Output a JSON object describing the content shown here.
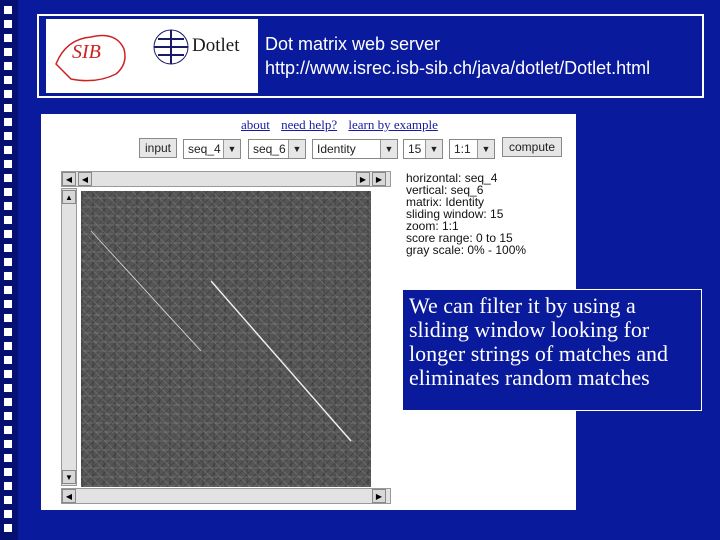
{
  "banner": {
    "title": "Dot matrix web server",
    "url": "http://www.isrec.isb-sib.ch/java/dotlet/Dotlet.html",
    "logo_left_text": "SIB",
    "logo_right_text": "Dotlet"
  },
  "links": [
    "about",
    "need help?",
    "learn by example"
  ],
  "toolbar": {
    "input_label": "input",
    "seq_h": "seq_4",
    "seq_v": "seq_6",
    "matrix": "Identity",
    "window": "15",
    "zoom": "1:1",
    "compute_label": "compute"
  },
  "info": {
    "horizontal": "horizontal: seq_4",
    "vertical": "vertical: seq_6",
    "matrix": "matrix: Identity",
    "window": "sliding window: 15",
    "zoom": "zoom: 1:1",
    "score": "score range: 0 to 15",
    "gray": "gray scale: 0% - 100%"
  },
  "caption": "We can filter it by using a sliding window looking  for longer strings of matches and eliminates random matches",
  "colors": {
    "background": "#0a1a9c",
    "plot": "#555555"
  }
}
